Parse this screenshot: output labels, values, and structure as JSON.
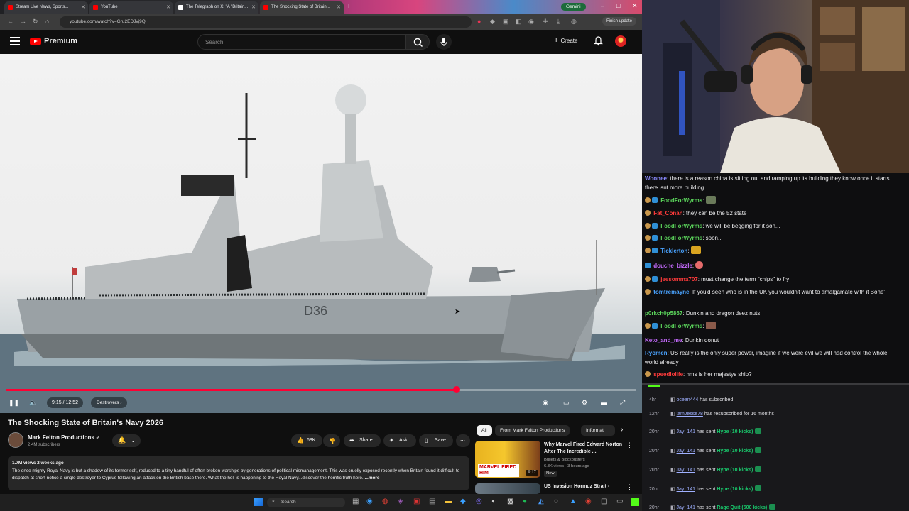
{
  "browser": {
    "tabs": [
      {
        "label": "Stream Live News, Sports..."
      },
      {
        "label": "YouTube"
      },
      {
        "label": "The Telegraph on X: \"A \"Britain..."
      },
      {
        "label": "The Shocking State of Britain..."
      }
    ],
    "url": "youtube.com/watch?v=Gru2EDJvj9Q",
    "gemini_label": "Gemini",
    "finish_update_label": "Finish update"
  },
  "masthead": {
    "logo_text": "Premium",
    "search_placeholder": "Search",
    "create_label": "Create"
  },
  "player": {
    "hull_number": "D36",
    "time": "9:15 / 12:52",
    "chapter": "Destroyers",
    "progress": 0.715
  },
  "video": {
    "title": "The Shocking State of Britain's Navy 2026",
    "channel": "Mark Felton Productions",
    "subscribers": "2.4M subscribers",
    "likes": "68K",
    "share_label": "Share",
    "ask_label": "Ask",
    "save_label": "Save",
    "views_age": "1.7M views  2 weeks ago",
    "description": "The once mighty Royal Navy is but a shadow of its former self, reduced to a tiny handful of often broken warships by generations of political mismanagement. This was cruelly exposed recently when Britain found it difficult to dispatch at short notice a single destroyer to Cyprus following an attack on the British base there. What the hell is happening to the Royal Navy...discover the horrific truth here.",
    "more_label": "...more"
  },
  "recommendations": {
    "chips": [
      "All",
      "From Mark Felton Productions",
      "Informati"
    ],
    "items": [
      {
        "title": "Why Marvel Fired Edward Norton After The Incredible ...",
        "channel": "Bullets & Blockbusters",
        "stats": "6.3K views · 3 hours ago",
        "badge": "New",
        "duration": "9:17",
        "thumb_text": "MARVEL FIRED HIM"
      },
      {
        "title": "US Invasion Hormuz Strait - Could It Be Another Okinawa",
        "channel": "",
        "stats": "",
        "badge": "",
        "duration": "",
        "thumb_text": ""
      }
    ]
  },
  "taskbar": {
    "search_label": "Search"
  },
  "chat": {
    "messages": [
      {
        "user": "Woonee",
        "color": "#8a8aff",
        "text": "there is a reason china is sitting out and ramping up its building they know once it starts there isnt more building"
      },
      {
        "user": "FoodForWyrms",
        "color": "#5bd45b",
        "text": ""
      },
      {
        "user": "Fat_Conan",
        "color": "#ff3b3b",
        "text": "they can be the 52 state"
      },
      {
        "user": "FoodForWyrms",
        "color": "#5bd45b",
        "text": "we will be begging for it son..."
      },
      {
        "user": "FoodForWyrms",
        "color": "#5bd45b",
        "text": "soon..."
      },
      {
        "user": "Ticklerton",
        "color": "#4aa3ff",
        "text": ""
      },
      {
        "user": "douche_bizzle",
        "color": "#c66bff",
        "text": ""
      },
      {
        "user": "jeesomma707",
        "color": "#ff3b3b",
        "text": "must change the term \"chips\" to fry"
      },
      {
        "user": "tomtremayne",
        "color": "#4aa3ff",
        "text": "If you'd seen who is in the UK you wouldn't want to amalgamate with it Bone'"
      },
      {
        "user": "p0rkch0p5867",
        "color": "#5bd45b",
        "text": "Dunkin and dragon deez nuts"
      },
      {
        "user": "FoodForWyrms",
        "color": "#5bd45b",
        "text": ""
      },
      {
        "user": "Keto_and_me",
        "color": "#c66bff",
        "text": "Dunkin donut"
      },
      {
        "user": "Ryomen",
        "color": "#4aa3ff",
        "text": "US really is the only super power, imagine if we were evil we will had control the whole world already"
      },
      {
        "user": "speedlolife",
        "color": "#ff3b3b",
        "text": "hms is her majestys ship?"
      }
    ]
  },
  "events": [
    {
      "age": "4hr",
      "user": "ocean444",
      "text": "has subscribed",
      "highlight": ""
    },
    {
      "age": "12hr",
      "user": "lamJesse78",
      "text": "has resubscribed for 16 months",
      "highlight": ""
    },
    {
      "age": "20hr",
      "user": "Jay_141",
      "text": "has sent",
      "highlight": "Hype (10 kicks)"
    },
    {
      "age": "20hr",
      "user": "Jay_141",
      "text": "has sent",
      "highlight": "Hype (10 kicks)"
    },
    {
      "age": "20hr",
      "user": "Jay_141",
      "text": "has sent",
      "highlight": "Hype (10 kicks)"
    },
    {
      "age": "20hr",
      "user": "Jay_141",
      "text": "has sent",
      "highlight": "Hype (10 kicks)"
    },
    {
      "age": "20hr",
      "user": "Jay_141",
      "text": "has sent",
      "highlight": "Rage Quit (500 kicks)"
    }
  ]
}
